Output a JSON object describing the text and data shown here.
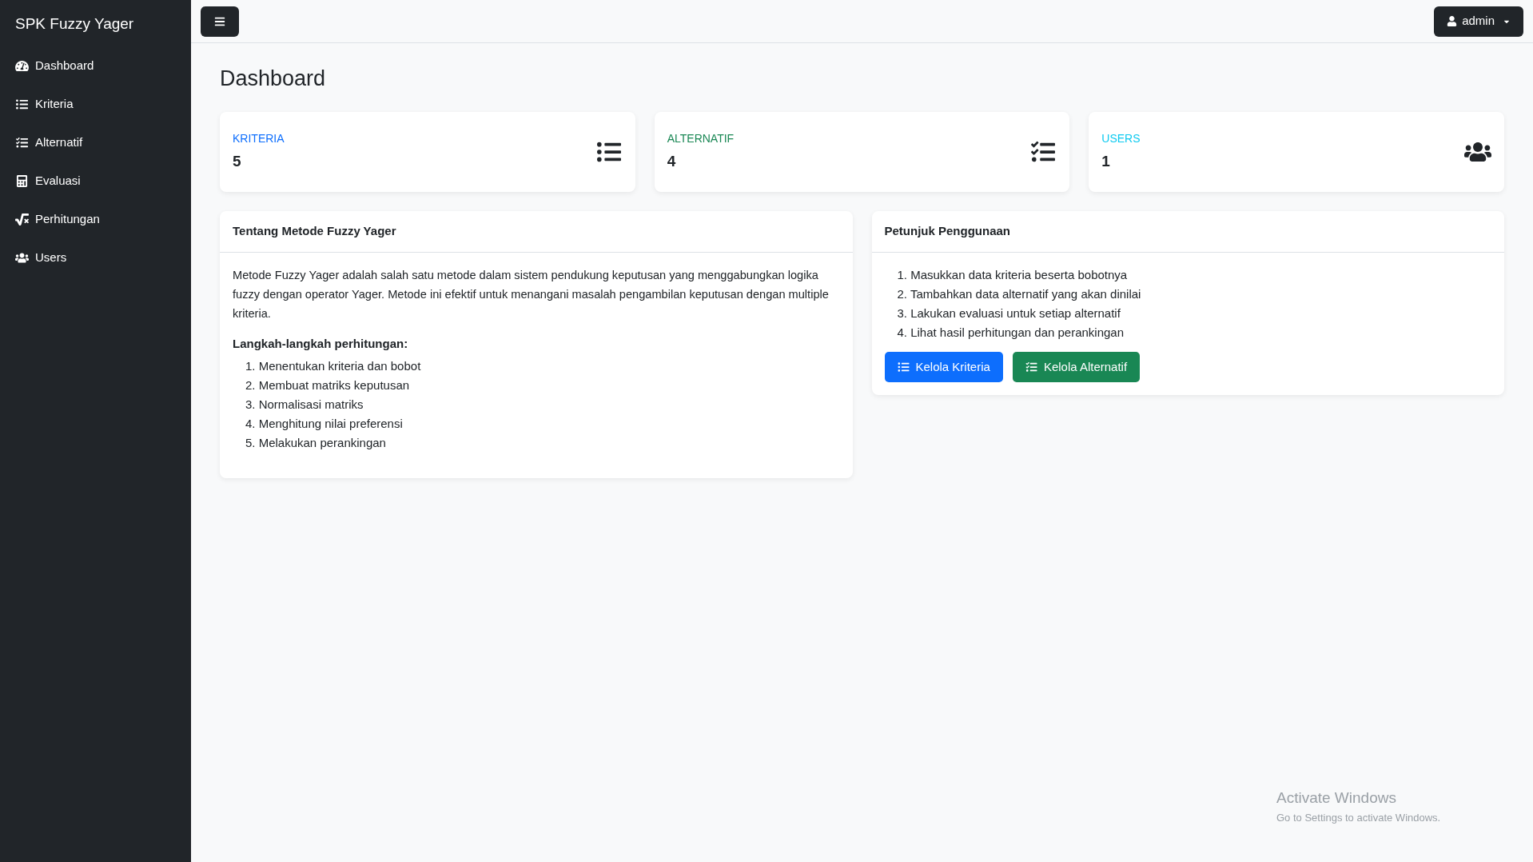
{
  "sidebar": {
    "brand": "SPK Fuzzy Yager",
    "items": [
      {
        "label": "Dashboard"
      },
      {
        "label": "Kriteria"
      },
      {
        "label": "Alternatif"
      },
      {
        "label": "Evaluasi"
      },
      {
        "label": "Perhitungan"
      },
      {
        "label": "Users"
      }
    ]
  },
  "topbar": {
    "user": "admin"
  },
  "page_title": "Dashboard",
  "stats": [
    {
      "label": "KRITERIA",
      "value": "5",
      "color": "#0d6efd"
    },
    {
      "label": "ALTERNATIF",
      "value": "4",
      "color": "#198754"
    },
    {
      "label": "USERS",
      "value": "1",
      "color": "#0dcaf0"
    }
  ],
  "about": {
    "title": "Tentang Metode Fuzzy Yager",
    "text": "Metode Fuzzy Yager adalah salah satu metode dalam sistem pendukung keputusan yang menggabungkan logika fuzzy dengan operator Yager. Metode ini efektif untuk menangani masalah pengambilan keputusan dengan multiple kriteria.",
    "steps_title": "Langkah-langkah perhitungan:",
    "steps": [
      "1. Menentukan kriteria dan bobot",
      "2. Membuat matriks keputusan",
      "3. Normalisasi matriks",
      "4. Menghitung nilai preferensi",
      "5. Melakukan perankingan"
    ]
  },
  "guide": {
    "title": "Petunjuk Penggunaan",
    "steps": [
      "1. Masukkan data kriteria beserta bobotnya",
      "2. Tambahkan data alternatif yang akan dinilai",
      "3. Lakukan evaluasi untuk setiap alternatif",
      "4. Lihat hasil perhitungan dan perankingan"
    ],
    "buttons": [
      {
        "label": "Kelola Kriteria",
        "color": "#0d6efd"
      },
      {
        "label": "Kelola Alternatif",
        "color": "#198754"
      }
    ]
  },
  "os_notice": {
    "title": "Activate Windows",
    "text": "Go to Settings to activate Windows."
  }
}
